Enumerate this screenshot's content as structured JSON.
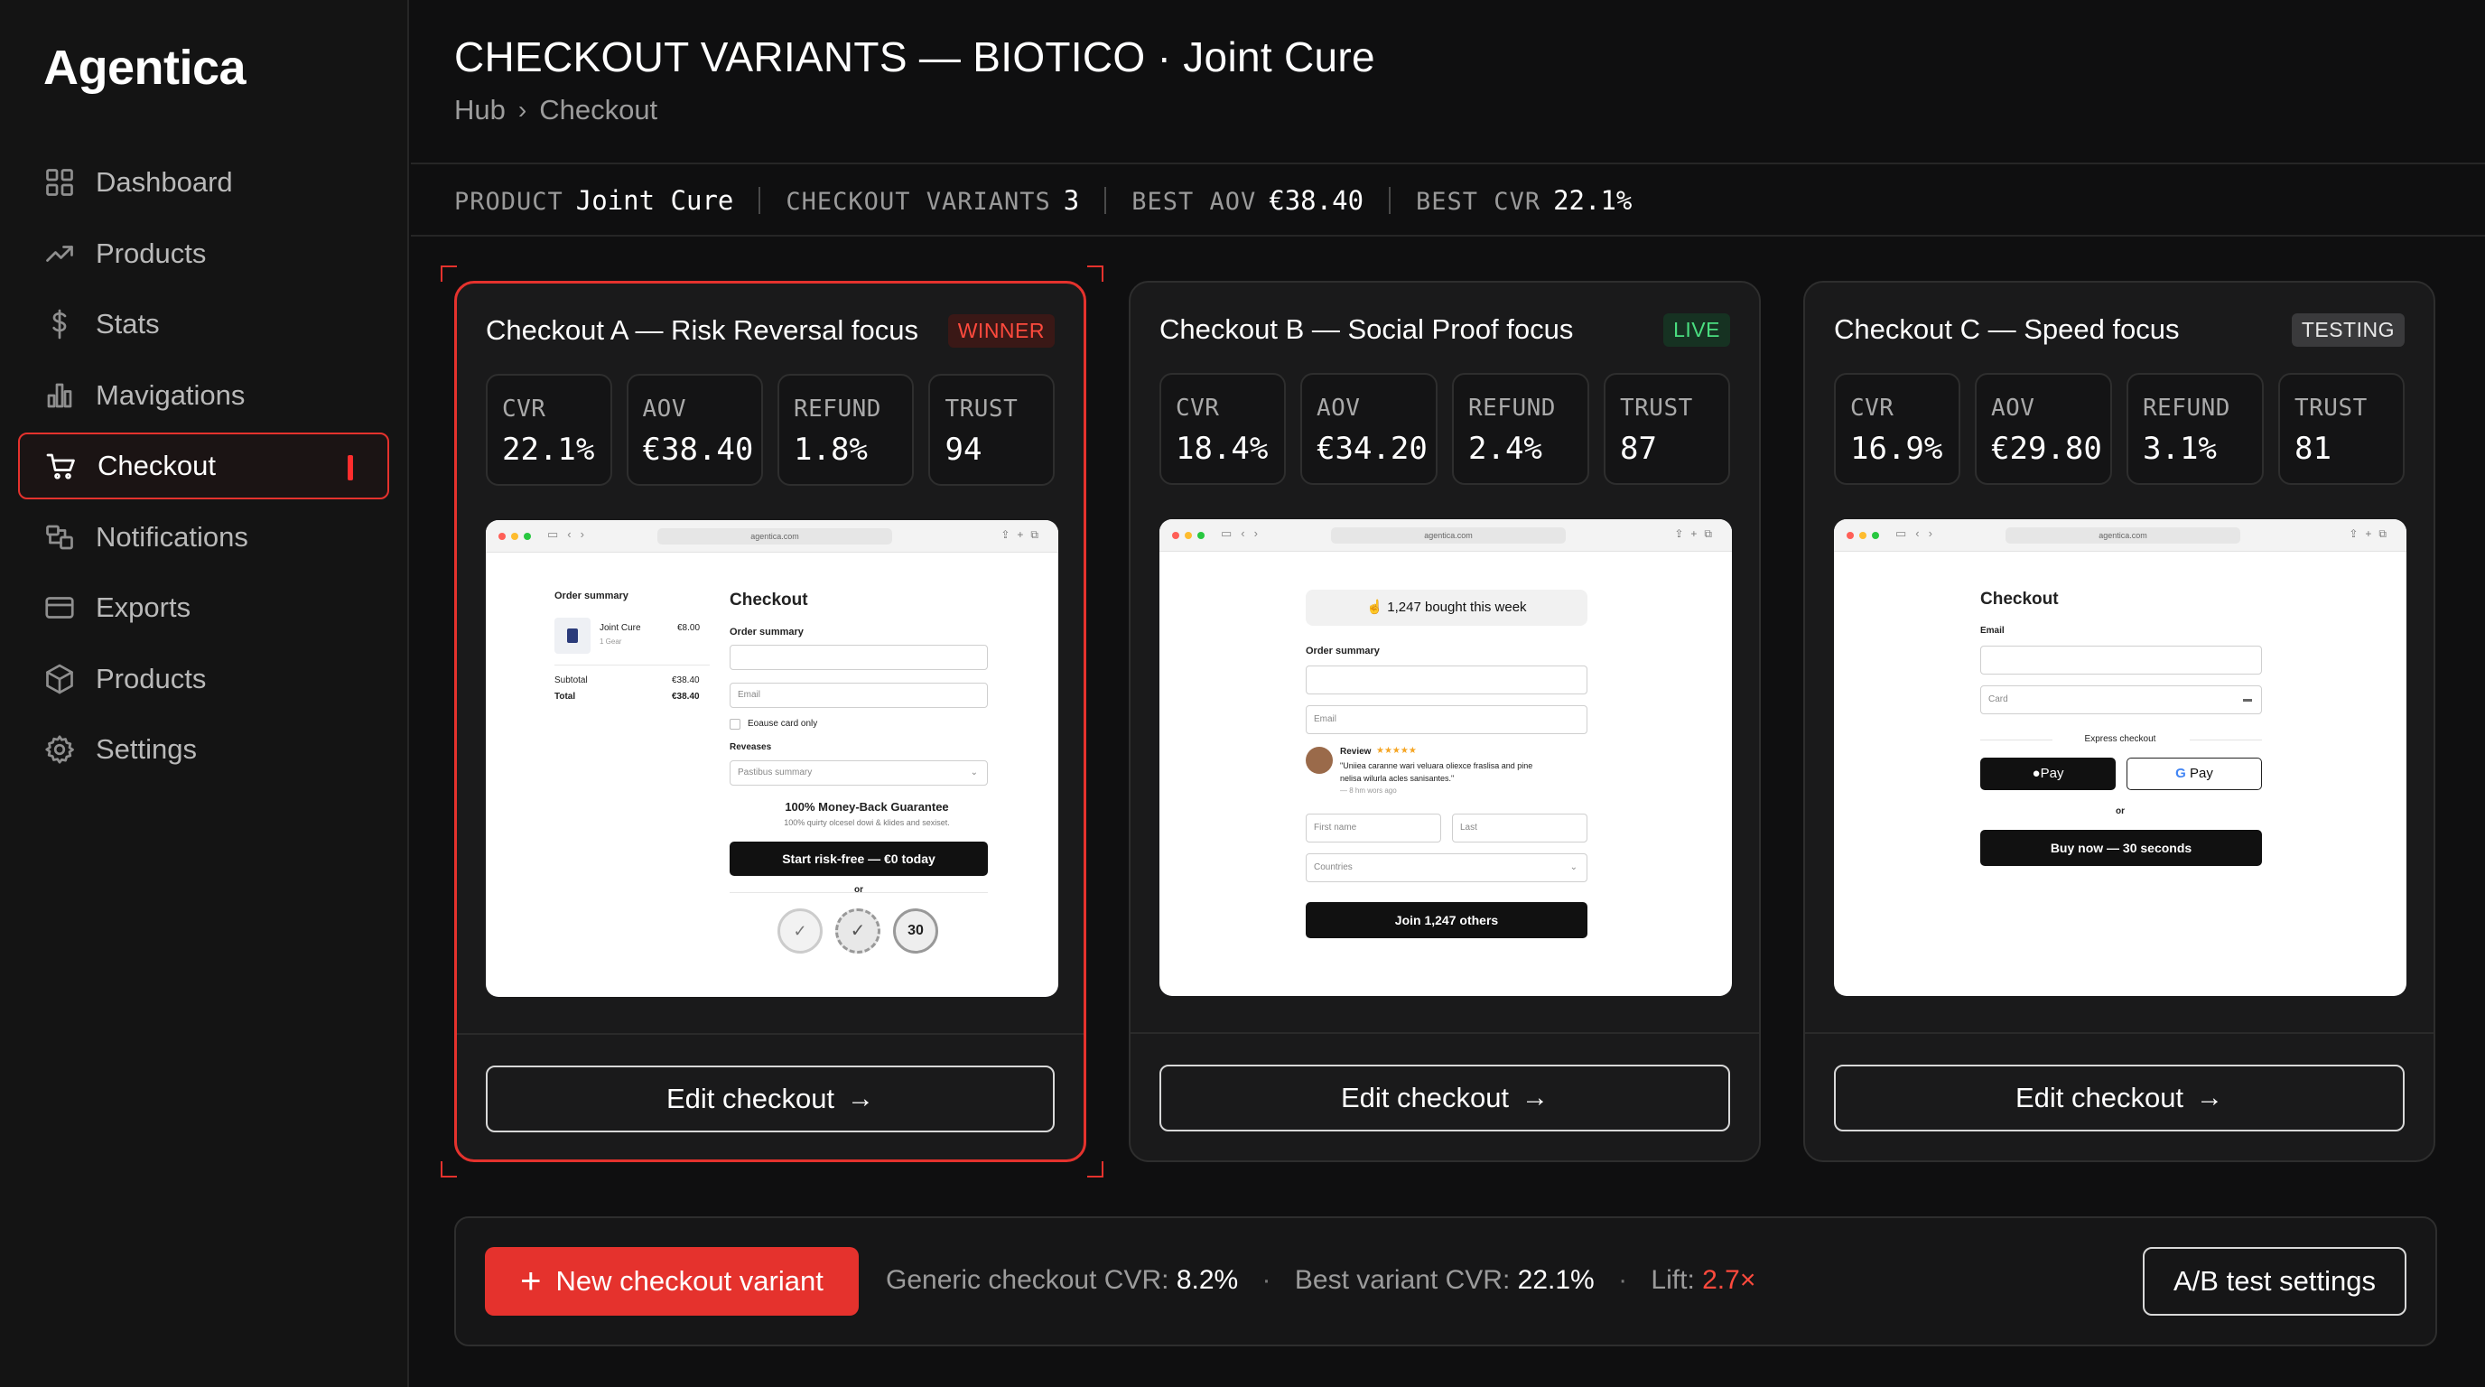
{
  "app": {
    "name": "Agentica"
  },
  "sidebar": {
    "items": [
      {
        "label": "Dashboard",
        "icon": "grid-icon"
      },
      {
        "label": "Products",
        "icon": "trend-icon"
      },
      {
        "label": "Stats",
        "icon": "dollar-icon"
      },
      {
        "label": "Mavigations",
        "icon": "bar-chart-icon"
      },
      {
        "label": "Checkout",
        "icon": "cart-icon",
        "active": true
      },
      {
        "label": "Notifications",
        "icon": "notification-icon"
      },
      {
        "label": "Exports",
        "icon": "card-icon"
      },
      {
        "label": "Products",
        "icon": "cube-icon"
      },
      {
        "label": "Settings",
        "icon": "gear-icon"
      }
    ]
  },
  "header": {
    "title": "CHECKOUT VARIANTS — BIOTICO · Joint Cure",
    "breadcrumb": [
      "Hub",
      "Checkout"
    ],
    "breadcrumb_sep": "›"
  },
  "statbar": [
    {
      "key": "PRODUCT",
      "value": "Joint Cure"
    },
    {
      "key": "CHECKOUT VARIANTS",
      "value": "3"
    },
    {
      "key": "BEST AOV",
      "value": "€38.40"
    },
    {
      "key": "BEST CVR",
      "value": "22.1%"
    }
  ],
  "cards": [
    {
      "title": "Checkout A — Risk Reversal focus",
      "badge": "WINNER",
      "metrics": [
        {
          "key": "CVR",
          "value": "22.1%"
        },
        {
          "key": "AOV",
          "value": "€38.40"
        },
        {
          "key": "REFUND",
          "value": "1.8%"
        },
        {
          "key": "TRUST",
          "value": "94"
        }
      ],
      "preview": {
        "url": "agentica.com",
        "order_summary": "Order summary",
        "product_name": "Joint Cure",
        "product_sub": "1 Gear",
        "product_price": "€8.00",
        "subtotal_label": "Subtotal",
        "subtotal_value": "€38.40",
        "total_label": "Total",
        "total_value": "€38.40",
        "heading": "Checkout",
        "form_label": "Order summary",
        "email_placeholder": "Email",
        "checkbox_label": "Eoause card only",
        "reveases_label": "Reveases",
        "select_value": "Pastibus summary",
        "guarantee_title": "100% Money-Back Guarantee",
        "guarantee_sub": "100% quirty olcesel dowi & klides and sexiset.",
        "cta": "Start risk-free — €0 today",
        "or": "or",
        "seal_number": "30"
      },
      "edit_label": "Edit checkout",
      "edit_arrow": "→"
    },
    {
      "title": "Checkout B — Social Proof focus",
      "badge": "LIVE",
      "metrics": [
        {
          "key": "CVR",
          "value": "18.4%"
        },
        {
          "key": "AOV",
          "value": "€34.20"
        },
        {
          "key": "REFUND",
          "value": "2.4%"
        },
        {
          "key": "TRUST",
          "value": "87"
        }
      ],
      "preview": {
        "url": "agentica.com",
        "social_pill": "1,247 bought this week",
        "order_summary": "Order summary",
        "email_placeholder": "Email",
        "review_label": "Review",
        "review_stars": "★★★★★",
        "review_text1": "\"Uniiea caranne wari veluara oliexce fraslisa and pine",
        "review_text2": "nelisa wilurla acles sanisantes.\"",
        "review_meta": "— 8 hm wors ago",
        "first_name": "First name",
        "last_name": "Last",
        "country": "Countries",
        "cta": "Join 1,247 others"
      },
      "edit_label": "Edit checkout",
      "edit_arrow": "→"
    },
    {
      "title": "Checkout C — Speed focus",
      "badge": "TESTING",
      "metrics": [
        {
          "key": "CVR",
          "value": "16.9%"
        },
        {
          "key": "AOV",
          "value": "€29.80"
        },
        {
          "key": "REFUND",
          "value": "3.1%"
        },
        {
          "key": "TRUST",
          "value": "81"
        }
      ],
      "preview": {
        "url": "agentica.com",
        "heading": "Checkout",
        "email_label": "Email",
        "card_placeholder": "Card",
        "express": "Express checkout",
        "apple_pay": "Pay",
        "google_pay": "Pay",
        "or": "or",
        "cta": "Buy now — 30 seconds"
      },
      "edit_label": "Edit checkout",
      "edit_arrow": "→"
    }
  ],
  "footer": {
    "new_variant": "New checkout variant",
    "plus": "+",
    "generic_label": "Generic checkout CVR:",
    "generic_value": "8.2%",
    "dot": "·",
    "best_label": "Best variant CVR:",
    "best_value": "22.1%",
    "lift_label": "Lift:",
    "lift_value": "2.7×",
    "ab_settings": "A/B test settings"
  },
  "colors": {
    "accent": "#e5322d",
    "live": "#4ade80",
    "background": "#0f0f10"
  }
}
